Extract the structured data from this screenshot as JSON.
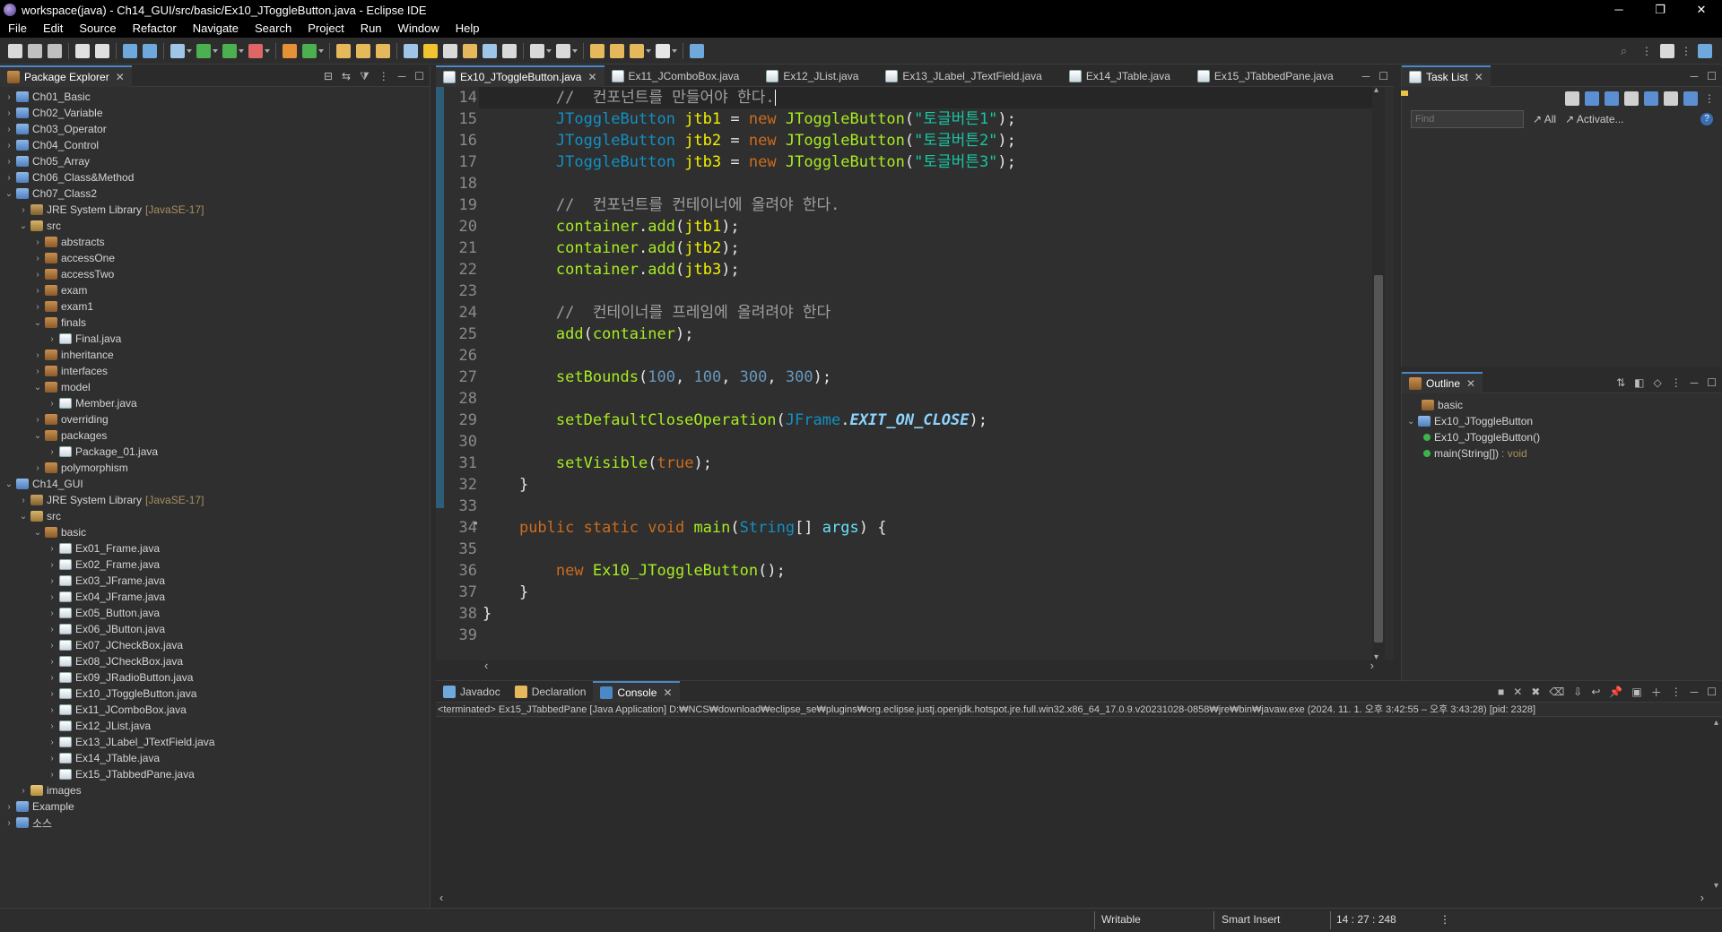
{
  "window": {
    "title": "workspace(java) - Ch14_GUI/src/basic/Ex10_JToggleButton.java - Eclipse IDE",
    "controls": [
      "─",
      "❐",
      "✕"
    ]
  },
  "menu": [
    "File",
    "Edit",
    "Source",
    "Refactor",
    "Navigate",
    "Search",
    "Project",
    "Run",
    "Window",
    "Help"
  ],
  "package_explorer": {
    "tab_label": "Package Explorer",
    "tree": [
      {
        "label": "Ch01_Basic",
        "indent": 0,
        "twisty": ">",
        "icon": "project"
      },
      {
        "label": "Ch02_Variable",
        "indent": 0,
        "twisty": ">",
        "icon": "project"
      },
      {
        "label": "Ch03_Operator",
        "indent": 0,
        "twisty": ">",
        "icon": "project"
      },
      {
        "label": "Ch04_Control",
        "indent": 0,
        "twisty": ">",
        "icon": "project"
      },
      {
        "label": "Ch05_Array",
        "indent": 0,
        "twisty": ">",
        "icon": "project"
      },
      {
        "label": "Ch06_Class&Method",
        "indent": 0,
        "twisty": ">",
        "icon": "project"
      },
      {
        "label": "Ch07_Class2",
        "indent": 0,
        "twisty": "v",
        "icon": "project"
      },
      {
        "label": "JRE System Library",
        "suffix": "[JavaSE-17]",
        "indent": 1,
        "twisty": ">",
        "icon": "library"
      },
      {
        "label": "src",
        "indent": 1,
        "twisty": "v",
        "icon": "src"
      },
      {
        "label": "abstracts",
        "indent": 2,
        "twisty": ">",
        "icon": "package"
      },
      {
        "label": "accessOne",
        "indent": 2,
        "twisty": ">",
        "icon": "package"
      },
      {
        "label": "accessTwo",
        "indent": 2,
        "twisty": ">",
        "icon": "package"
      },
      {
        "label": "exam",
        "indent": 2,
        "twisty": ">",
        "icon": "package"
      },
      {
        "label": "exam1",
        "indent": 2,
        "twisty": ">",
        "icon": "package"
      },
      {
        "label": "finals",
        "indent": 2,
        "twisty": "v",
        "icon": "package"
      },
      {
        "label": "Final.java",
        "indent": 3,
        "twisty": ">",
        "icon": "java"
      },
      {
        "label": "inheritance",
        "indent": 2,
        "twisty": ">",
        "icon": "package"
      },
      {
        "label": "interfaces",
        "indent": 2,
        "twisty": ">",
        "icon": "package"
      },
      {
        "label": "model",
        "indent": 2,
        "twisty": "v",
        "icon": "package"
      },
      {
        "label": "Member.java",
        "indent": 3,
        "twisty": ">",
        "icon": "java"
      },
      {
        "label": "overriding",
        "indent": 2,
        "twisty": ">",
        "icon": "package"
      },
      {
        "label": "packages",
        "indent": 2,
        "twisty": "v",
        "icon": "package"
      },
      {
        "label": "Package_01.java",
        "indent": 3,
        "twisty": ">",
        "icon": "java"
      },
      {
        "label": "polymorphism",
        "indent": 2,
        "twisty": ">",
        "icon": "package"
      },
      {
        "label": "Ch14_GUI",
        "indent": 0,
        "twisty": "v",
        "icon": "project"
      },
      {
        "label": "JRE System Library",
        "suffix": "[JavaSE-17]",
        "indent": 1,
        "twisty": ">",
        "icon": "library"
      },
      {
        "label": "src",
        "indent": 1,
        "twisty": "v",
        "icon": "src"
      },
      {
        "label": "basic",
        "indent": 2,
        "twisty": "v",
        "icon": "package"
      },
      {
        "label": "Ex01_Frame.java",
        "indent": 3,
        "twisty": ">",
        "icon": "java"
      },
      {
        "label": "Ex02_Frame.java",
        "indent": 3,
        "twisty": ">",
        "icon": "java"
      },
      {
        "label": "Ex03_JFrame.java",
        "indent": 3,
        "twisty": ">",
        "icon": "java"
      },
      {
        "label": "Ex04_JFrame.java",
        "indent": 3,
        "twisty": ">",
        "icon": "java"
      },
      {
        "label": "Ex05_Button.java",
        "indent": 3,
        "twisty": ">",
        "icon": "java"
      },
      {
        "label": "Ex06_JButton.java",
        "indent": 3,
        "twisty": ">",
        "icon": "java"
      },
      {
        "label": "Ex07_JCheckBox.java",
        "indent": 3,
        "twisty": ">",
        "icon": "java"
      },
      {
        "label": "Ex08_JCheckBox.java",
        "indent": 3,
        "twisty": ">",
        "icon": "java"
      },
      {
        "label": "Ex09_JRadioButton.java",
        "indent": 3,
        "twisty": ">",
        "icon": "java"
      },
      {
        "label": "Ex10_JToggleButton.java",
        "indent": 3,
        "twisty": ">",
        "icon": "java"
      },
      {
        "label": "Ex11_JComboBox.java",
        "indent": 3,
        "twisty": ">",
        "icon": "java"
      },
      {
        "label": "Ex12_JList.java",
        "indent": 3,
        "twisty": ">",
        "icon": "java"
      },
      {
        "label": "Ex13_JLabel_JTextField.java",
        "indent": 3,
        "twisty": ">",
        "icon": "java"
      },
      {
        "label": "Ex14_JTable.java",
        "indent": 3,
        "twisty": ">",
        "icon": "java"
      },
      {
        "label": "Ex15_JTabbedPane.java",
        "indent": 3,
        "twisty": ">",
        "icon": "java"
      },
      {
        "label": "images",
        "indent": 1,
        "twisty": ">",
        "icon": "folder"
      },
      {
        "label": "Example",
        "indent": 0,
        "twisty": ">",
        "icon": "project"
      },
      {
        "label": "소스",
        "indent": 0,
        "twisty": ">",
        "icon": "project"
      }
    ]
  },
  "editor": {
    "tabs": [
      {
        "label": "Ex10_JToggleButton.java",
        "active": true
      },
      {
        "label": "Ex11_JComboBox.java",
        "active": false
      },
      {
        "label": "Ex12_JList.java",
        "active": false
      },
      {
        "label": "Ex13_JLabel_JTextField.java",
        "active": false
      },
      {
        "label": "Ex14_JTable.java",
        "active": false
      },
      {
        "label": "Ex15_JTabbedPane.java",
        "active": false
      }
    ],
    "first_line_partial": "13",
    "lines": [
      {
        "n": "14",
        "tokens": [
          [
            "plain",
            "\t\t"
          ],
          [
            "comment",
            "//  컨포넌트를 만들어야 한다."
          ]
        ],
        "current": true
      },
      {
        "n": "15",
        "tokens": [
          [
            "plain",
            "\t\t"
          ],
          [
            "type",
            "JToggleButton"
          ],
          [
            "plain",
            " "
          ],
          [
            "var",
            "jtb1"
          ],
          [
            "plain",
            " = "
          ],
          [
            "kw",
            "new"
          ],
          [
            "plain",
            " "
          ],
          [
            "method",
            "JToggleButton"
          ],
          [
            "plain",
            "("
          ],
          [
            "str",
            "\"토글버튼1\""
          ],
          [
            "plain",
            ");"
          ]
        ]
      },
      {
        "n": "16",
        "tokens": [
          [
            "plain",
            "\t\t"
          ],
          [
            "type",
            "JToggleButton"
          ],
          [
            "plain",
            " "
          ],
          [
            "var",
            "jtb2"
          ],
          [
            "plain",
            " = "
          ],
          [
            "kw",
            "new"
          ],
          [
            "plain",
            " "
          ],
          [
            "method",
            "JToggleButton"
          ],
          [
            "plain",
            "("
          ],
          [
            "str",
            "\"토글버튼2\""
          ],
          [
            "plain",
            ");"
          ]
        ]
      },
      {
        "n": "17",
        "tokens": [
          [
            "plain",
            "\t\t"
          ],
          [
            "type",
            "JToggleButton"
          ],
          [
            "plain",
            " "
          ],
          [
            "var",
            "jtb3"
          ],
          [
            "plain",
            " = "
          ],
          [
            "kw",
            "new"
          ],
          [
            "plain",
            " "
          ],
          [
            "method",
            "JToggleButton"
          ],
          [
            "plain",
            "("
          ],
          [
            "str",
            "\"토글버튼3\""
          ],
          [
            "plain",
            ");"
          ]
        ]
      },
      {
        "n": "18",
        "tokens": []
      },
      {
        "n": "19",
        "tokens": [
          [
            "plain",
            "\t\t"
          ],
          [
            "comment",
            "//  컨포넌트를 컨테이너에 올려야 한다."
          ]
        ]
      },
      {
        "n": "20",
        "tokens": [
          [
            "plain",
            "\t\t"
          ],
          [
            "method",
            "container"
          ],
          [
            "plain",
            "."
          ],
          [
            "method",
            "add"
          ],
          [
            "plain",
            "("
          ],
          [
            "var",
            "jtb1"
          ],
          [
            "plain",
            ");"
          ]
        ]
      },
      {
        "n": "21",
        "tokens": [
          [
            "plain",
            "\t\t"
          ],
          [
            "method",
            "container"
          ],
          [
            "plain",
            "."
          ],
          [
            "method",
            "add"
          ],
          [
            "plain",
            "("
          ],
          [
            "var",
            "jtb2"
          ],
          [
            "plain",
            ");"
          ]
        ]
      },
      {
        "n": "22",
        "tokens": [
          [
            "plain",
            "\t\t"
          ],
          [
            "method",
            "container"
          ],
          [
            "plain",
            "."
          ],
          [
            "method",
            "add"
          ],
          [
            "plain",
            "("
          ],
          [
            "var",
            "jtb3"
          ],
          [
            "plain",
            ");"
          ]
        ]
      },
      {
        "n": "23",
        "tokens": []
      },
      {
        "n": "24",
        "tokens": [
          [
            "plain",
            "\t\t"
          ],
          [
            "comment",
            "//  컨테이너를 프레임에 올려려야 한다"
          ]
        ]
      },
      {
        "n": "25",
        "tokens": [
          [
            "plain",
            "\t\t"
          ],
          [
            "method",
            "add"
          ],
          [
            "plain",
            "("
          ],
          [
            "method",
            "container"
          ],
          [
            "plain",
            ");"
          ]
        ]
      },
      {
        "n": "26",
        "tokens": []
      },
      {
        "n": "27",
        "tokens": [
          [
            "plain",
            "\t\t"
          ],
          [
            "method",
            "setBounds"
          ],
          [
            "plain",
            "("
          ],
          [
            "num",
            "100"
          ],
          [
            "plain",
            ", "
          ],
          [
            "num",
            "100"
          ],
          [
            "plain",
            ", "
          ],
          [
            "num",
            "300"
          ],
          [
            "plain",
            ", "
          ],
          [
            "num",
            "300"
          ],
          [
            "plain",
            ");"
          ]
        ]
      },
      {
        "n": "28",
        "tokens": []
      },
      {
        "n": "29",
        "tokens": [
          [
            "plain",
            "\t\t"
          ],
          [
            "method",
            "setDefaultCloseOperation"
          ],
          [
            "plain",
            "("
          ],
          [
            "type",
            "JFrame"
          ],
          [
            "plain",
            "."
          ],
          [
            "const",
            "EXIT_ON_CLOSE"
          ],
          [
            "plain",
            ");"
          ]
        ]
      },
      {
        "n": "30",
        "tokens": []
      },
      {
        "n": "31",
        "tokens": [
          [
            "plain",
            "\t\t"
          ],
          [
            "method",
            "setVisible"
          ],
          [
            "plain",
            "("
          ],
          [
            "kw",
            "true"
          ],
          [
            "plain",
            ");"
          ]
        ]
      },
      {
        "n": "32",
        "tokens": [
          [
            "plain",
            "\t}"
          ]
        ]
      },
      {
        "n": "33",
        "tokens": []
      },
      {
        "n": "34",
        "tokens": [
          [
            "plain",
            "\t"
          ],
          [
            "kw",
            "public static void"
          ],
          [
            "plain",
            " "
          ],
          [
            "method",
            "main"
          ],
          [
            "plain",
            "("
          ],
          [
            "type",
            "String"
          ],
          [
            "plain",
            "[] "
          ],
          [
            "field",
            "args"
          ],
          [
            "plain",
            ") {"
          ]
        ],
        "marker": true
      },
      {
        "n": "35",
        "tokens": []
      },
      {
        "n": "36",
        "tokens": [
          [
            "plain",
            "\t\t"
          ],
          [
            "kw",
            "new"
          ],
          [
            "plain",
            " "
          ],
          [
            "method",
            "Ex10_JToggleButton"
          ],
          [
            "plain",
            "();"
          ]
        ]
      },
      {
        "n": "37",
        "tokens": [
          [
            "plain",
            "\t}"
          ]
        ]
      },
      {
        "n": "38",
        "tokens": [
          [
            "plain",
            "}"
          ]
        ]
      },
      {
        "n": "39",
        "tokens": []
      }
    ]
  },
  "task_list": {
    "tab_label": "Task List",
    "find_placeholder": "Find",
    "all_label": "All",
    "activate_label": "Activate..."
  },
  "outline": {
    "tab_label": "Outline",
    "items": [
      {
        "label": "basic",
        "indent": 0,
        "type": ""
      },
      {
        "label": "Ex10_JToggleButton",
        "indent": 0,
        "type": ""
      },
      {
        "label": "Ex10_JToggleButton()",
        "indent": 1,
        "type": ""
      },
      {
        "label": "main(String[])",
        "indent": 1,
        "type": ": void"
      }
    ]
  },
  "console": {
    "tabs": [
      {
        "label": "Javadoc",
        "active": false
      },
      {
        "label": "Declaration",
        "active": false
      },
      {
        "label": "Console",
        "active": true
      }
    ],
    "status": "<terminated> Ex15_JTabbedPane [Java Application] D:₩NCS₩download₩eclipse_se₩plugins₩org.eclipse.justj.openjdk.hotspot.jre.full.win32.x86_64_17.0.9.v20231028-0858₩jre₩bin₩javaw.exe  (2024. 11. 1. 오후 3:42:55 – 오후 3:43:28) [pid: 2328]"
  },
  "statusbar": {
    "writable": "Writable",
    "insert_mode": "Smart Insert",
    "position": "14 : 27 : 248"
  }
}
